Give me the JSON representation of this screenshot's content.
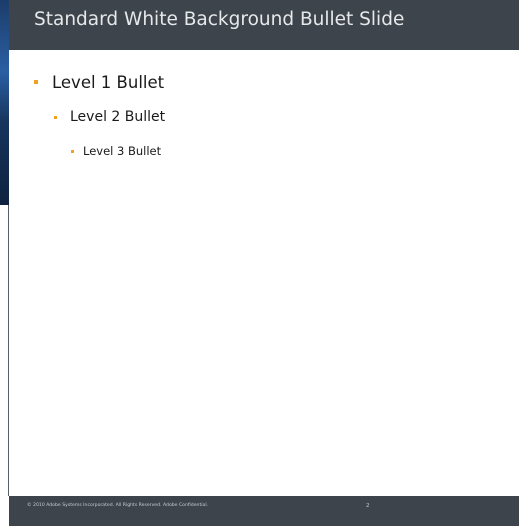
{
  "slide": {
    "title": "Standard White Background Bullet Slide",
    "bullets": [
      {
        "level": 1,
        "text": "Level 1 Bullet"
      },
      {
        "level": 2,
        "text": "Level 2 Bullet"
      },
      {
        "level": 3,
        "text": "Level 3 Bullet"
      }
    ],
    "footer": {
      "copyright": "© 2010 Adobe Systems Incorporated.  All Rights Reserved.  Adobe Confidential.",
      "page_number": "2"
    }
  },
  "colors": {
    "title_bar": "#3d444c",
    "bullet_accent": "#f0a21e",
    "body_background": "#ffffff"
  }
}
